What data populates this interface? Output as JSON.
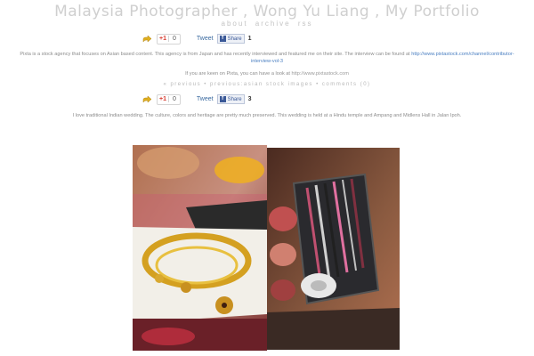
{
  "header": {
    "title": "Malaysia Photographer , Wong Yu Liang , My Portfolio",
    "nav": [
      "about",
      "archive",
      "rss"
    ]
  },
  "share": {
    "gplus_label": "+1",
    "gplus_count": "0",
    "tweet_label": "Tweet",
    "fb_label": "Share",
    "fb_count_1": "1",
    "fb_count_2": "3"
  },
  "post1": {
    "text_a": "Pixta is a stock agency that focuses on Asian based content. This agency is from Japan and has recently interviewed and featured me on their site. The interview can be found at",
    "link": "http://www.pixtastock.com/channel/contributor-interview-vol-3",
    "text_b": "If you are keen on Pixta, you can have a look at",
    "link2": "http://www.pixtastock.com"
  },
  "prevnext": "« previous • previous:asian stock images • comments (0)",
  "post2": {
    "text": "I love traditional Indian wedding. The culture, colors and heritage are pretty much preserved. This wedding is held at a Hindu temple and Ampang and Midlens Hall in Jalan Ipoh."
  },
  "colors": {
    "title": "#cfcfcf",
    "link": "#4a7fc1",
    "facebook": "#3b5998",
    "gplus_red": "#d73d32"
  }
}
